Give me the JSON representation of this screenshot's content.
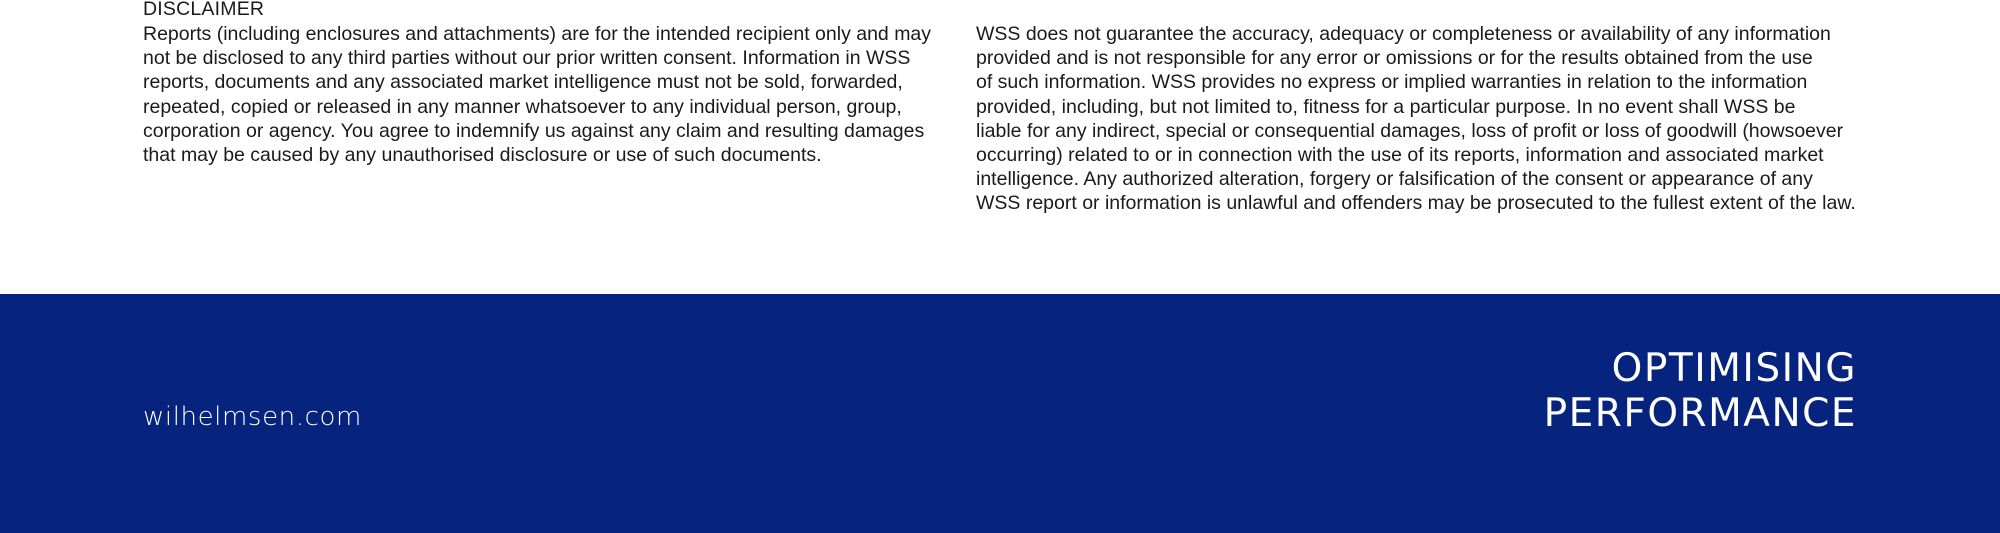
{
  "disclaimer": {
    "heading": "DISCLAIMER",
    "left_text": "Reports (including enclosures and attachments) are for the intended recipient only and may\nnot be disclosed to any third parties without our prior written consent. Information in WSS\nreports, documents and any associated market intelligence must not be sold, forwarded,\nrepeated, copied or released in any manner whatsoever to any individual person, group,\ncorporation or agency. You agree to indemnify us against any claim and resulting damages\nthat may be caused by any unauthorised disclosure or use of such documents.",
    "right_text": "WSS does not guarantee the accuracy, adequacy or completeness or availability of any information\nprovided and is not responsible for any error or omissions or for the results obtained from the use\nof such information. WSS provides no express or implied warranties in relation to the information\nprovided, including, but not limited to, fitness for a particular purpose. In no event shall WSS be\nliable for any indirect, special or consequential damages, loss of profit or loss of goodwill (howsoever\noccurring) related to or in connection with the use of its reports, information and associated market\nintelligence. Any authorized alteration, forgery or falsification of the consent or appearance of any\nWSS report or information is unlawful and offenders may be prosecuted to the fullest extent of the law."
  },
  "footer": {
    "website": "wilhelmsen.com",
    "tagline_line1": "OPTIMISING",
    "tagline_line2": "PERFORMANCE",
    "background_color": "#06237e",
    "text_color": "#ffffff"
  }
}
